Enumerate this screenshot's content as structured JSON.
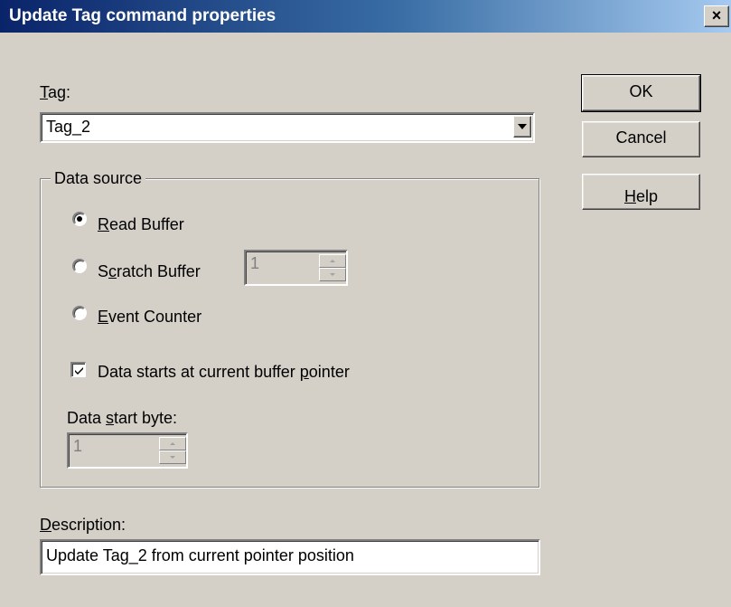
{
  "window": {
    "title": "Update Tag command properties",
    "close_glyph": "×"
  },
  "tag": {
    "label": "Tag:",
    "mnemonic": "T",
    "label_rest": "ag:",
    "value": "Tag_2"
  },
  "buttons": {
    "ok": "OK",
    "cancel": "Cancel",
    "help": "Help",
    "help_mnemonic": "H",
    "help_rest": "elp"
  },
  "data_source": {
    "legend": "Data source",
    "options": [
      {
        "label": "Read Buffer",
        "mnemonic": "R",
        "rest": "ead Buffer",
        "selected": true
      },
      {
        "label": "Scratch Buffer",
        "pre": "S",
        "mnemonic": "c",
        "rest": "ratch Buffer",
        "selected": false
      },
      {
        "label": "Event Counter",
        "mnemonic": "E",
        "rest": "vent Counter",
        "selected": false
      }
    ],
    "scratch_value": "1",
    "checkbox": {
      "label": "Data starts at current buffer pointer",
      "pre": "Data starts at current buffer ",
      "mnemonic": "p",
      "rest": "ointer",
      "checked": true
    },
    "start_byte": {
      "label": "Data start byte:",
      "pre": "Data ",
      "mnemonic": "s",
      "rest": "tart byte:",
      "value": "1"
    }
  },
  "description": {
    "label": "Description:",
    "mnemonic": "D",
    "rest": "escription:",
    "value": "Update Tag_2 from current pointer position"
  },
  "colors": {
    "face": "#d4d0c8",
    "title_start": "#0a246a",
    "title_end": "#a6caf0"
  }
}
